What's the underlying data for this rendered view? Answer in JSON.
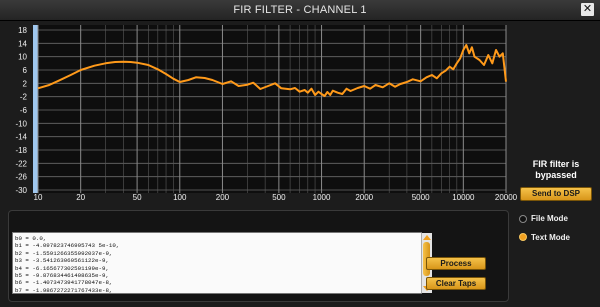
{
  "window": {
    "title": "FIR FILTER - CHANNEL 1",
    "close_icon": "close-icon"
  },
  "chart_data": {
    "type": "line",
    "xscale": "log",
    "xlim": [
      10,
      20000
    ],
    "ylim": [
      -30,
      18
    ],
    "yticks": [
      18,
      14,
      10,
      6,
      2,
      -2,
      -6,
      -10,
      -14,
      -18,
      -22,
      -26,
      -30
    ],
    "yticklabels": [
      "18",
      "14",
      "10",
      "6",
      "2",
      "-2",
      "-6",
      "-10",
      "-14",
      "-18",
      "-22",
      "-26",
      "-30"
    ],
    "xticks": [
      10,
      20,
      50,
      100,
      200,
      500,
      1000,
      2000,
      5000,
      10000,
      20000
    ],
    "xticklabels": [
      "10",
      "20",
      "50",
      "100",
      "200",
      "500",
      "1000",
      "2000",
      "5000",
      "10000",
      "20000"
    ],
    "grid": true,
    "line_color": "#ff9a1a",
    "series": [
      {
        "x": [
          10,
          12,
          14,
          17,
          20,
          25,
          30,
          35,
          40,
          45,
          50,
          60,
          70,
          80,
          90,
          100,
          115,
          130,
          150,
          170,
          200,
          230,
          260,
          300,
          330,
          370,
          420,
          470,
          520,
          600,
          650,
          700,
          760,
          800,
          850,
          900,
          950,
          1000,
          1050,
          1100,
          1150,
          1200,
          1300,
          1400,
          1500,
          1600,
          1800,
          2000,
          2200,
          2400,
          2700,
          3000,
          3300,
          3600,
          4000,
          4400,
          5000,
          5500,
          6000,
          6500,
          7000,
          7500,
          8000,
          8500,
          9000,
          9500,
          10000,
          10500,
          11000,
          11500,
          12000,
          13000,
          14000,
          15000,
          16000,
          17000,
          18000,
          19000,
          20000
        ],
        "y": [
          0.5,
          1.5,
          2.8,
          4.5,
          6,
          7.3,
          8,
          8.4,
          8.5,
          8.4,
          8.2,
          7.5,
          6.2,
          4.8,
          3.4,
          2.4,
          3,
          3.8,
          3.6,
          3,
          1.8,
          2.6,
          1.2,
          1.6,
          2.2,
          0.3,
          1.2,
          2,
          0.5,
          0.2,
          0.6,
          -0.5,
          0,
          -0.8,
          0.4,
          -1.5,
          -0.5,
          -1.2,
          -1.8,
          -0.6,
          -1.5,
          -0.2,
          -0.8,
          -1.2,
          0.4,
          -0.3,
          0.6,
          1.2,
          0.4,
          1.5,
          0.8,
          2,
          1,
          1.8,
          2.4,
          3.2,
          2.6,
          3.8,
          4.5,
          3.5,
          5,
          5.8,
          7,
          6.2,
          8,
          9.5,
          12,
          13.5,
          11,
          12.8,
          10,
          9,
          7.5,
          10.5,
          8,
          12,
          10,
          11,
          2.5
        ]
      }
    ]
  },
  "status": {
    "line1": "FIR filter is",
    "line2": "bypassed"
  },
  "buttons": {
    "send": "Send to DSP",
    "process": "Process",
    "clear": "Clear Taps"
  },
  "modes": [
    {
      "label": "File Mode",
      "selected": false
    },
    {
      "label": "Text Mode",
      "selected": true
    }
  ],
  "taps": [
    "b0 = 0.0,",
    "b1 = -4.097823746995743 5e-10,",
    "b2 = -1.5591266355992037e-9,",
    "b3 = -3.541263060561122e-9,",
    "b4 = -6.165677302501199e-9,",
    "b5 = -9.876834461408635e-9,",
    "b6 = -1.4073473941778047e-8,",
    "b7 = -1.9867272271767433e-8,"
  ]
}
